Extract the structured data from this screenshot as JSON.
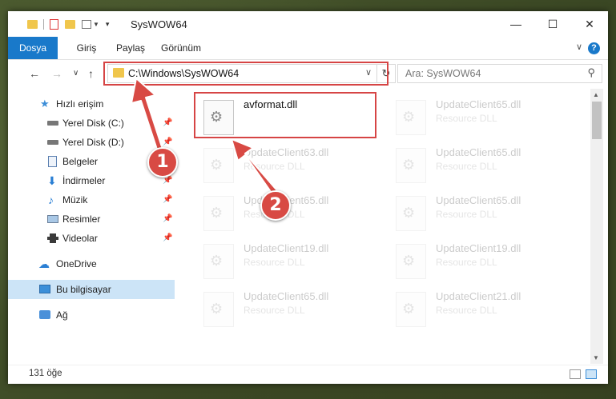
{
  "window": {
    "title": "SysWOW64",
    "controls": {
      "minimize": "—",
      "maximize": "☐",
      "close": "✕"
    }
  },
  "ribbon": {
    "tabs": [
      "Dosya",
      "Giriş",
      "Paylaş",
      "Görünüm"
    ],
    "help": "?",
    "collapse": "∨"
  },
  "nav": {
    "back": "←",
    "forward": "→",
    "recent": "∨",
    "up": "↑",
    "address": "C:\\Windows\\SysWOW64",
    "address_dropdown": "∨",
    "refresh": "↻",
    "search_placeholder": "Ara: SysWOW64",
    "search_icon": "⚲"
  },
  "sidebar": {
    "items": [
      {
        "label": "Hızlı erişim",
        "icon": "star-icon",
        "pinned": false
      },
      {
        "label": "Yerel Disk (C:)",
        "icon": "drive-icon",
        "pinned": true
      },
      {
        "label": "Yerel Disk (D:)",
        "icon": "drive-icon",
        "pinned": true
      },
      {
        "label": "Belgeler",
        "icon": "documents-icon",
        "pinned": true
      },
      {
        "label": "İndirmeler",
        "icon": "downloads-icon",
        "pinned": true
      },
      {
        "label": "Müzik",
        "icon": "music-icon",
        "pinned": true
      },
      {
        "label": "Resimler",
        "icon": "pictures-icon",
        "pinned": true
      },
      {
        "label": "Videolar",
        "icon": "videos-icon",
        "pinned": true
      },
      {
        "label": "OneDrive",
        "icon": "onedrive-icon",
        "pinned": false
      },
      {
        "label": "Bu bilgisayar",
        "icon": "computer-icon",
        "pinned": false,
        "selected": true
      },
      {
        "label": "Ağ",
        "icon": "network-icon",
        "pinned": false
      }
    ],
    "pin_glyph": "📌"
  },
  "files": [
    {
      "name": "avformat.dll",
      "type": "",
      "highlighted": true
    },
    {
      "name": "UpdateClient65.dll",
      "type": "Resource DLL"
    },
    {
      "name": "UpdateClient63.dll",
      "type": "Resource DLL"
    },
    {
      "name": "UpdateClient65.dll",
      "type": "Resource DLL"
    },
    {
      "name": "UpdateClient65.dll",
      "type": "Resource DLL"
    },
    {
      "name": "UpdateClient65.dll",
      "type": "Resource DLL"
    },
    {
      "name": "UpdateClient19.dll",
      "type": "Resource DLL"
    },
    {
      "name": "UpdateClient19.dll",
      "type": "Resource DLL"
    },
    {
      "name": "UpdateClient65.dll",
      "type": "Resource DLL"
    },
    {
      "name": "UpdateClient21.dll",
      "type": "Resource DLL"
    }
  ],
  "status": {
    "count": "131 öğe"
  },
  "annotations": {
    "step1": "1",
    "step2": "2",
    "color": "#d84a44"
  },
  "colors": {
    "accent": "#1979ca",
    "selected": "#cce4f7",
    "highlight_box": "#d64545"
  }
}
